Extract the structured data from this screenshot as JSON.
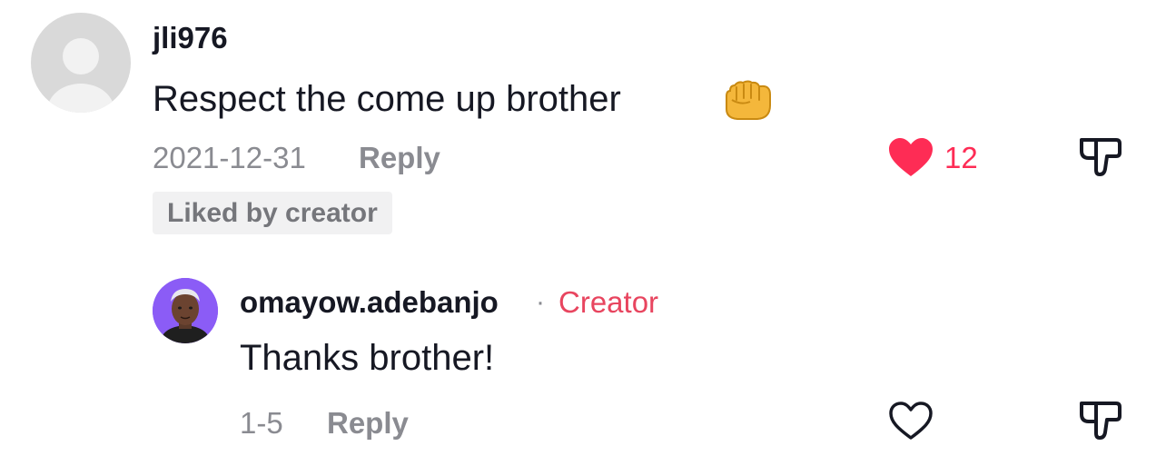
{
  "comments": [
    {
      "username": "jli976",
      "text": "Respect the come up brother",
      "emoji": "👊",
      "date": "2021-12-31",
      "reply_label": "Reply",
      "like_count": "12",
      "liked": true,
      "badge": "Liked by creator",
      "avatar": "default-avatar"
    },
    {
      "username": "omayow.adebanjo",
      "separator": "·",
      "creator_label": "Creator",
      "text": "Thanks brother!",
      "date": "1-5",
      "reply_label": "Reply",
      "liked": false,
      "avatar": "creator-avatar"
    }
  ],
  "colors": {
    "like_red": "#fe2c55",
    "creator_tag": "#e8455f",
    "meta_gray": "#8a8b91",
    "text_dark": "#161823"
  },
  "icons": [
    "heart-filled-icon",
    "heart-outline-icon",
    "thumbs-down-icon",
    "fist-emoji-icon"
  ]
}
